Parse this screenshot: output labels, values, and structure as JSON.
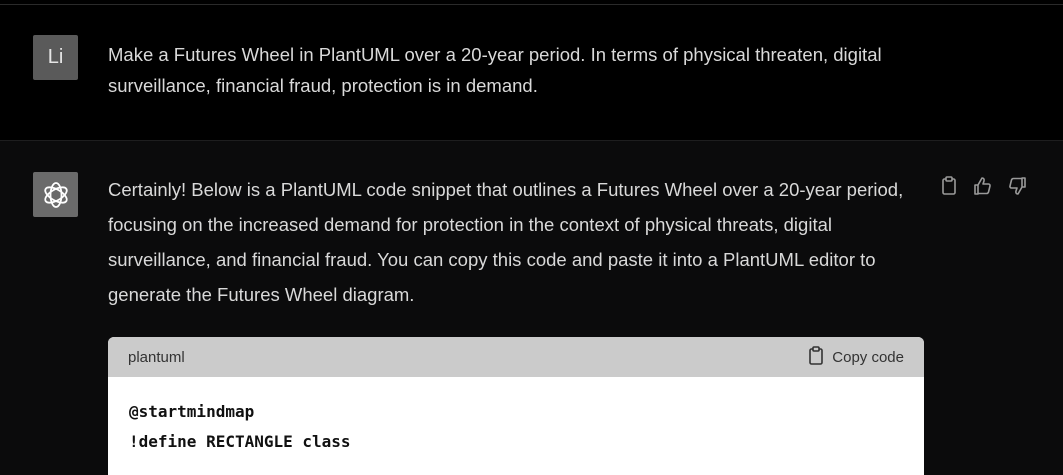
{
  "user_message": {
    "avatar_initials": "Li",
    "text": "Make a Futures Wheel in PlantUML over a 20-year period. In terms of physical threaten, digital surveillance, financial fraud, protection is in demand."
  },
  "assistant_message": {
    "avatar_icon": "openai-logo-icon",
    "text": "Certainly! Below is a PlantUML code snippet that outlines a Futures Wheel over a 20-year period, focusing on the increased demand for protection in the context of physical threats, digital surveillance, and financial fraud. You can copy this code and paste it into a PlantUML editor to generate the Futures Wheel diagram.",
    "actions": [
      "clipboard-icon",
      "thumbs-up-icon",
      "thumbs-down-icon"
    ]
  },
  "code_block": {
    "language": "plantuml",
    "copy_label": "Copy code",
    "lines": [
      "@startmindmap",
      "!define RECTANGLE class"
    ]
  }
}
